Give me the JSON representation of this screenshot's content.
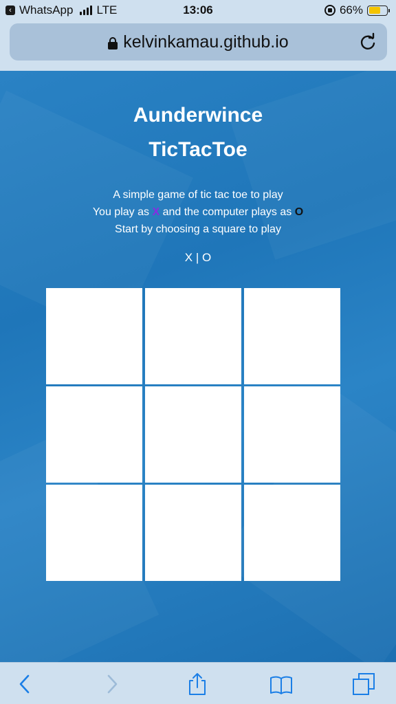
{
  "status_bar": {
    "back_app": "WhatsApp",
    "network": "LTE",
    "time": "13:06",
    "battery": "66%",
    "battery_level": 0.66,
    "icons": [
      "back-app-icon",
      "signal-icon",
      "rotation-lock-icon",
      "battery-icon"
    ]
  },
  "browser": {
    "url": "kelvinkamau.github.io",
    "icons": [
      "lock-icon",
      "reload-icon"
    ]
  },
  "page": {
    "title_line1": "Aunderwince",
    "title_line2": "TicTacToe",
    "desc_line1": "A simple game of tic tac toe to play",
    "desc_line2_prefix": "You play as",
    "player_mark": "X",
    "desc_line2_middle": "and the computer plays as",
    "computer_mark": "O",
    "desc_line3": "Start by choosing a square to play",
    "score": "X | O",
    "board": [
      "",
      "",
      "",
      "",
      "",
      "",
      "",
      "",
      ""
    ]
  },
  "toolbar": {
    "icons": [
      "back-icon",
      "forward-icon",
      "share-icon",
      "bookmarks-icon",
      "tabs-icon"
    ]
  },
  "colors": {
    "page_background": "#2178bc",
    "player_mark": "#8a2be2",
    "computer_mark": "#111111",
    "cell": "#ffffff"
  }
}
